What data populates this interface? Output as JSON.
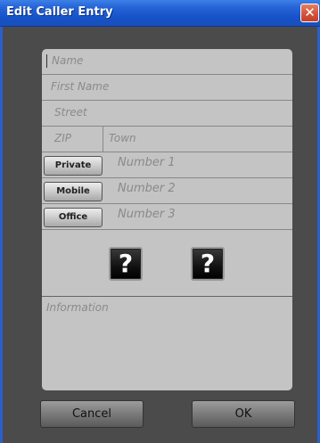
{
  "window": {
    "title": "Edit Caller Entry",
    "close_glyph": "✕"
  },
  "form": {
    "name_placeholder": "Name",
    "first_name_placeholder": "First Name",
    "street_placeholder": "Street",
    "zip_placeholder": "ZIP",
    "town_placeholder": "Town",
    "phones": [
      {
        "type_label": "Private",
        "number_placeholder": "Number 1"
      },
      {
        "type_label": "Mobile",
        "number_placeholder": "Number 2"
      },
      {
        "type_label": "Office",
        "number_placeholder": "Number 3"
      }
    ],
    "help_buttons": [
      "?",
      "?"
    ],
    "information_placeholder": "Information"
  },
  "actions": {
    "cancel_label": "Cancel",
    "ok_label": "OK"
  },
  "colors": {
    "titlebar": "#1552c8",
    "background": "#4b4b4b",
    "panel": "#c4c4c4",
    "placeholder_text": "#8a8a8a"
  }
}
